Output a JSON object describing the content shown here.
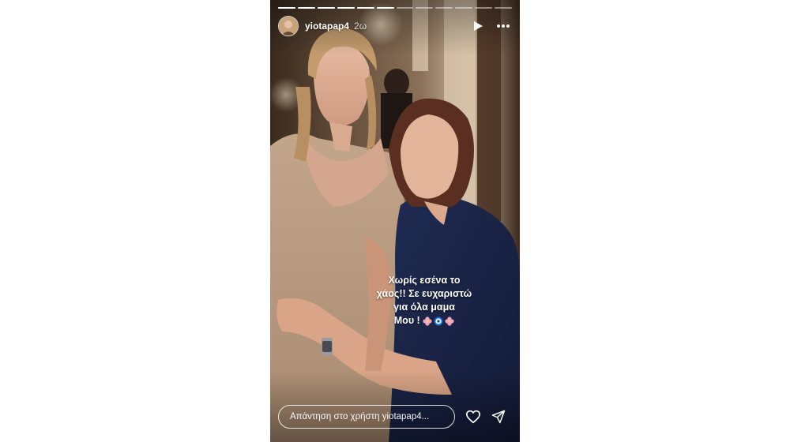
{
  "story": {
    "username": "yiotapap4",
    "time_ago": "2ω",
    "segments": [
      1,
      1,
      1,
      1,
      1,
      1,
      0,
      0,
      0,
      0,
      0,
      0
    ],
    "caption_lines": [
      "Χωρίς εσένα το",
      "χάος!! Σε ευχαριστώ",
      "για όλα μαμα",
      "Μου !"
    ],
    "caption_emojis": [
      "flower-icon",
      "evil-eye-icon",
      "flower-icon"
    ],
    "reply_placeholder": "Απάντηση στο χρήστη yiotapap4...",
    "icons": {
      "play": "play-icon",
      "more": "more-icon",
      "like": "heart-icon",
      "send": "send-icon"
    },
    "colors": {
      "flower": "#f4a3c4",
      "evil_eye": "#1e6bd6"
    }
  }
}
